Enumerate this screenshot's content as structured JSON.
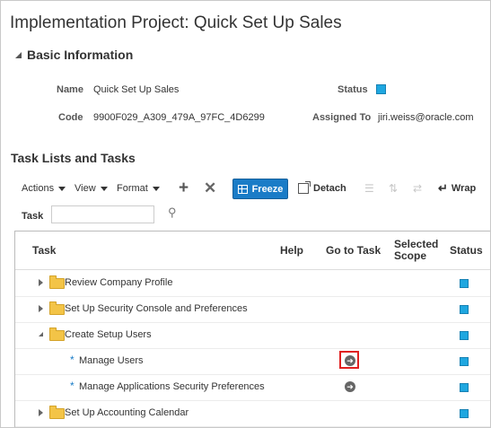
{
  "page_title": "Implementation Project: Quick Set Up Sales",
  "basic_info": {
    "heading": "Basic Information",
    "name_label": "Name",
    "name_value": "Quick Set Up Sales",
    "code_label": "Code",
    "code_value": "9900F029_A309_479A_97FC_4D6299",
    "status_label": "Status",
    "assigned_label": "Assigned To",
    "assigned_value": "jiri.weiss@oracle.com",
    "status_color": "#1fa7e0"
  },
  "tasks_section": {
    "heading": "Task Lists and Tasks",
    "toolbar": {
      "actions": "Actions",
      "view": "View",
      "format": "Format",
      "add_icon": "plus-icon",
      "remove_icon": "x-icon",
      "freeze": "Freeze",
      "detach": "Detach",
      "wrap": "Wrap"
    },
    "filter": {
      "label": "Task",
      "value": ""
    },
    "columns": {
      "task": "Task",
      "help": "Help",
      "goto": "Go to Task",
      "scope_line1": "Selected",
      "scope_line2": "Scope",
      "status": "Status"
    },
    "rows": [
      {
        "label": "Review Company Profile",
        "type": "folder",
        "expanded": false
      },
      {
        "label": "Set Up Security Console and Preferences",
        "type": "folder",
        "expanded": false
      },
      {
        "label": "Create Setup Users",
        "type": "folder",
        "expanded": true
      },
      {
        "label": "Manage Users",
        "type": "task",
        "required_mark": "*",
        "highlighted": true
      },
      {
        "label": "Manage Applications Security Preferences",
        "type": "task",
        "required_mark": "*",
        "highlighted": false
      },
      {
        "label": "Set Up Accounting Calendar",
        "type": "folder",
        "expanded": false
      }
    ]
  }
}
